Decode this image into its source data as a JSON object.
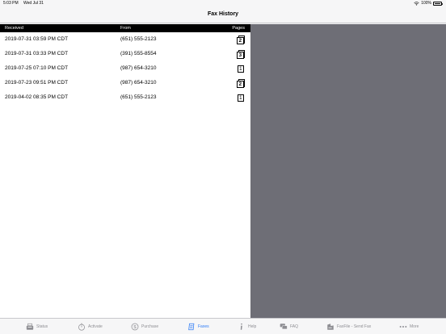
{
  "status_bar": {
    "time": "5:03 PM",
    "date": "Wed Jul 31",
    "battery": "100%",
    "icons": [
      "wifi-icon",
      "battery-icon"
    ]
  },
  "nav": {
    "title": "Fax History"
  },
  "table": {
    "headers": {
      "received": "Received",
      "from": "From",
      "pages": "Pages"
    },
    "rows": [
      {
        "received": "2019-07-31 03:59 PM CDT",
        "from": "(651) 555-2123",
        "pages": "2"
      },
      {
        "received": "2019-07-31 03:33 PM CDT",
        "from": "(391) 555-8554",
        "pages": "3"
      },
      {
        "received": "2019-07-25 07:10 PM CDT",
        "from": "(987) 654-3210",
        "pages": "1"
      },
      {
        "received": "2019-07-23 09:51 PM CDT",
        "from": "(987) 654-3210",
        "pages": "2"
      },
      {
        "received": "2019-04-02 08:35 PM CDT",
        "from": "(651) 555-2123",
        "pages": "1"
      }
    ]
  },
  "tabs": [
    {
      "label": "Status",
      "icon": "fax-machine-icon",
      "active": false
    },
    {
      "label": "Activate",
      "icon": "stopwatch-icon",
      "active": false
    },
    {
      "label": "Purchase",
      "icon": "dollar-coin-icon",
      "active": false
    },
    {
      "label": "Faxes",
      "icon": "fax-document-icon",
      "active": true
    },
    {
      "label": "Help",
      "icon": "info-icon",
      "active": false
    },
    {
      "label": "FAQ",
      "icon": "chat-bubbles-icon",
      "active": false
    },
    {
      "label": "FaxFile - Send Fax",
      "icon": "send-fax-icon",
      "active": false
    },
    {
      "label": "More",
      "icon": "more-dots-icon",
      "active": false
    }
  ],
  "colors": {
    "active_tab": "#2d7bf6",
    "inactive_tab": "#8e8e93",
    "header_bg": "#000000",
    "detail_bg": "#6e6e76"
  }
}
